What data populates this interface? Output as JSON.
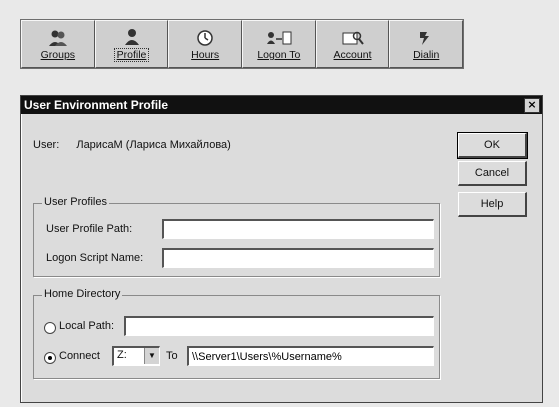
{
  "toolbar": {
    "buttons": [
      {
        "label": "Groups",
        "icon": "groups-icon"
      },
      {
        "label": "Profile",
        "icon": "profile-icon"
      },
      {
        "label": "Hours",
        "icon": "clock-icon"
      },
      {
        "label": "Logon To",
        "icon": "logon-to-icon"
      },
      {
        "label": "Account",
        "icon": "account-icon"
      },
      {
        "label": "Dialin",
        "icon": "dialin-icon"
      }
    ],
    "active_index": 1
  },
  "dialog": {
    "title": "User Environment Profile",
    "close_glyph": "×",
    "user_label": "User:",
    "user_value": "ЛарисаМ (Лариса Михайлова)",
    "ok_label": "OK",
    "cancel_label": "Cancel",
    "help_label": "Help",
    "user_profiles": {
      "title": "User Profiles",
      "profile_path_label": "User Profile Path:",
      "profile_path_value": "",
      "logon_script_label": "Logon Script Name:",
      "logon_script_value": ""
    },
    "home_directory": {
      "title": "Home Directory",
      "local_path_label": "Local Path:",
      "local_path_value": "",
      "connect_label": "Connect",
      "drive_value": "Z:",
      "to_label": "To",
      "to_value": "\\\\Server1\\Users\\%Username%",
      "selected": "connect"
    }
  }
}
